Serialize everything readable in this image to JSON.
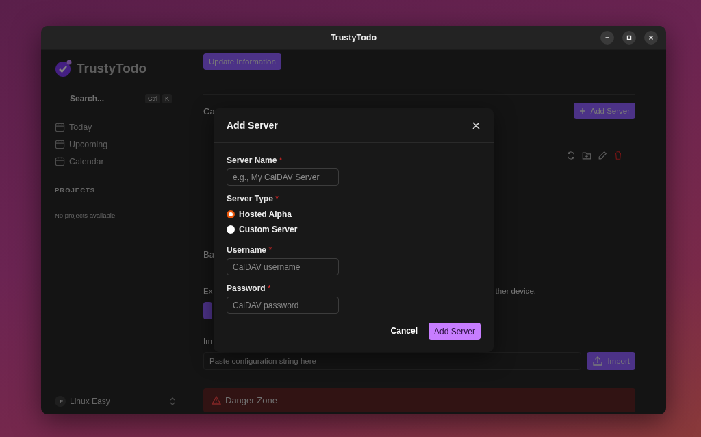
{
  "window": {
    "title": "TrustyTodo"
  },
  "sidebar": {
    "logo": "TrustyTodo",
    "search": {
      "placeholder": "Search...",
      "keys": [
        "Ctrl",
        "K"
      ]
    },
    "nav": [
      {
        "label": "Today"
      },
      {
        "label": "Upcoming"
      },
      {
        "label": "Calendar"
      }
    ],
    "projects_heading": "PROJECTS",
    "projects_empty": "No projects available",
    "user": {
      "initials": "LE",
      "name": "Linux Easy"
    }
  },
  "main": {
    "update_button": "Update Information",
    "calendar_heading": "Ca",
    "add_server_button": "Add Server",
    "backup_heading": "Ba",
    "backup_text_start": "Ex",
    "backup_text_end": "ther device.",
    "import_label": "Im",
    "import_field": {
      "placeholder": "Paste configuration string here"
    },
    "import_button": "Import",
    "danger_heading": "Danger Zone"
  },
  "dialog": {
    "title": "Add Server",
    "fields": [
      {
        "kind": "text",
        "label": "Server Name",
        "required_mark": "*",
        "placeholder": "e.g., My CalDAV Server"
      },
      {
        "kind": "radio",
        "label": "Server Type",
        "required_mark": "*",
        "options": [
          {
            "label": "Hosted Alpha",
            "selected": true
          },
          {
            "label": "Custom Server",
            "selected": false
          }
        ]
      },
      {
        "kind": "text",
        "label": "Username",
        "required_mark": "*",
        "placeholder": "CalDAV username"
      },
      {
        "kind": "password",
        "label": "Password",
        "required_mark": "*",
        "placeholder": "CalDAV password"
      }
    ],
    "cancel_button": "Cancel",
    "submit_button": "Add Server"
  }
}
